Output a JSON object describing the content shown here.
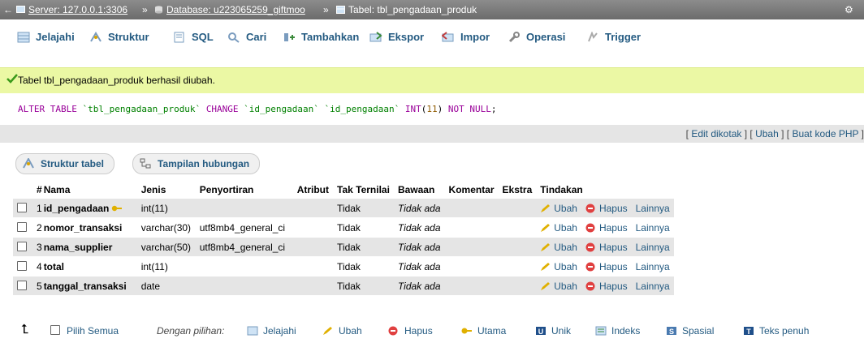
{
  "breadcrumb": {
    "server": "Server: 127.0.0.1:3306",
    "database": "Database: u223065259_giftmoo",
    "table": "Tabel: tbl_pengadaan_produk",
    "separator": "»"
  },
  "tabs": [
    "Jelajahi",
    "Struktur",
    "SQL",
    "Cari",
    "Tambahkan",
    "Ekspor",
    "Impor",
    "Operasi",
    "Trigger"
  ],
  "success_message": "Tabel tbl_pengadaan_produk berhasil diubah.",
  "sql": {
    "p1": "ALTER TABLE",
    "p2": " `tbl_pengadaan_produk` ",
    "p3": "CHANGE",
    "p4": " `id_pengadaan` `id_pengadaan` ",
    "p5": "INT",
    "p6": "(",
    "p7": "11",
    "p8": ") ",
    "p9": "NOT NULL",
    "p10": ";"
  },
  "sql_links": {
    "open": "[",
    "edit": "Edit dikotak",
    "mid1": "] [",
    "ubah": "Ubah",
    "mid2": "] [",
    "php": "Buat kode PHP",
    "close": "]"
  },
  "view_buttons": {
    "structure": "Struktur tabel",
    "relations": "Tampilan hubungan"
  },
  "table": {
    "headers": [
      "#",
      "Nama",
      "Jenis",
      "Penyortiran",
      "Atribut",
      "Tak Ternilai",
      "Bawaan",
      "Komentar",
      "Ekstra",
      "Tindakan"
    ],
    "rows": [
      {
        "no": "1",
        "name": "id_pengadaan",
        "type": "int(11)",
        "collation": "",
        "null": "Tidak",
        "default": "Tidak ada"
      },
      {
        "no": "2",
        "name": "nomor_transaksi",
        "type": "varchar(30)",
        "collation": "utf8mb4_general_ci",
        "null": "Tidak",
        "default": "Tidak ada"
      },
      {
        "no": "3",
        "name": "nama_supplier",
        "type": "varchar(50)",
        "collation": "utf8mb4_general_ci",
        "null": "Tidak",
        "default": "Tidak ada"
      },
      {
        "no": "4",
        "name": "total",
        "type": "int(11)",
        "collation": "",
        "null": "Tidak",
        "default": "Tidak ada"
      },
      {
        "no": "5",
        "name": "tanggal_transaksi",
        "type": "date",
        "collation": "",
        "null": "Tidak",
        "default": "Tidak ada"
      }
    ],
    "actions": {
      "edit": "Ubah",
      "drop": "Hapus",
      "more": "Lainnya"
    }
  },
  "bottom": {
    "select_all": "Pilih Semua",
    "with_selected": "Dengan pilihan:",
    "browse": "Jelajahi",
    "change": "Ubah",
    "drop": "Hapus",
    "primary": "Utama",
    "unique": "Unik",
    "index": "Indeks",
    "spatial": "Spasial",
    "fulltext": "Teks penuh"
  },
  "colors": {
    "link": "#235a81",
    "success_bg": "#ebf8a4",
    "topbar": "#7a7a7a",
    "row_even": "#e5e5e5"
  }
}
